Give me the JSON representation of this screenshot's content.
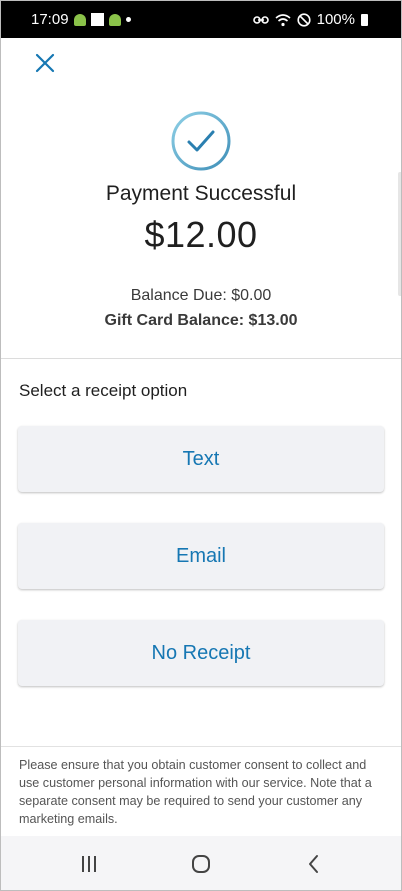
{
  "status_bar": {
    "time": "17:09",
    "battery": "100%",
    "icons_left": [
      "android-icon",
      "square-icon",
      "android-icon",
      "dot-icon"
    ],
    "icons_right": [
      "link-icon",
      "wifi-icon",
      "do-not-disturb-icon",
      "battery-icon"
    ]
  },
  "payment": {
    "title": "Payment Successful",
    "amount": "$12.00",
    "balance_due": "Balance Due: $0.00",
    "gift_card_balance": "Gift Card Balance: $13.00"
  },
  "receipt": {
    "label": "Select a receipt option",
    "options": [
      "Text",
      "Email",
      "No Receipt"
    ]
  },
  "notice": "Please ensure that you obtain customer consent to collect and use customer personal information with our service. Note that a separate consent may be required to send your customer any marketing emails.",
  "colors": {
    "accent": "#1677b3",
    "check_ring": "#5aa8cc",
    "button_bg": "#f1f2f5"
  },
  "navigation": [
    "recent-apps-icon",
    "home-icon",
    "back-icon"
  ]
}
